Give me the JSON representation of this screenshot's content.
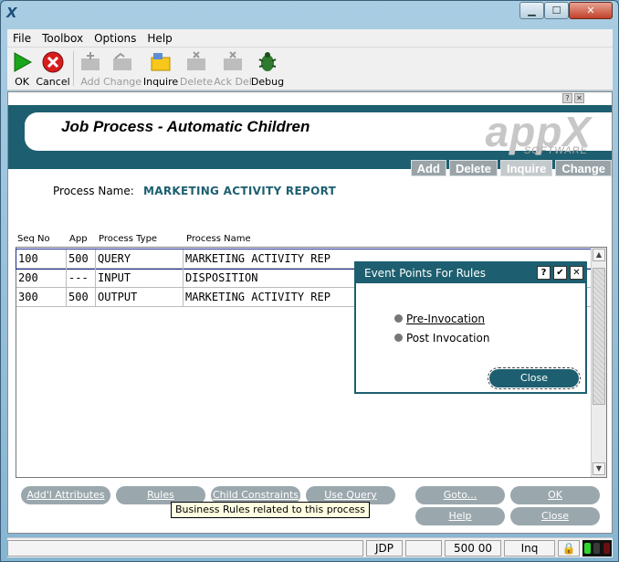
{
  "window": {
    "app_icon": "X"
  },
  "menu": [
    "File",
    "Toolbox",
    "Options",
    "Help"
  ],
  "toolbar": {
    "ok": "OK",
    "cancel": "Cancel",
    "add": "Add",
    "change": "Change",
    "inquire": "Inquire",
    "delete": "Delete",
    "ack_del": "Ack Del",
    "debug": "Debug"
  },
  "header": {
    "title": "Job Process - Automatic Children",
    "logo_text": "appX",
    "logo_sub": "SOFTWARE",
    "mode_tabs": [
      "Add",
      "Delete",
      "Inquire",
      "Change"
    ]
  },
  "process": {
    "label": "Process Name:",
    "value": "MARKETING ACTIVITY REPORT"
  },
  "table": {
    "headers": [
      "Seq No",
      "App",
      "Process Type",
      "Process Name"
    ],
    "rows": [
      {
        "seq": "100",
        "app": "500",
        "type": "QUERY",
        "name": "MARKETING ACTIVITY REP"
      },
      {
        "seq": "200",
        "app": "---",
        "type": "INPUT",
        "name": "DISPOSITION"
      },
      {
        "seq": "300",
        "app": "500",
        "type": "OUTPUT",
        "name": "MARKETING ACTIVITY REP"
      }
    ]
  },
  "popup": {
    "title": "Event Points For Rules",
    "help_btn": "?",
    "ok_btn": "✔",
    "close_btn": "✕",
    "options": [
      "Pre-Invocation",
      "Post Invocation"
    ],
    "close_label": "Close"
  },
  "buttons": {
    "addl_attributes": "Add'l Attributes",
    "rules": "Rules",
    "child_constraints": "Child Constraints",
    "use_query": "Use Query",
    "goto": "Goto...",
    "ok": "OK",
    "help": "Help",
    "close": "Close"
  },
  "tooltip": "Business Rules related to this process",
  "status": {
    "user": "JDP",
    "app_info": "500 00",
    "mode": "Inq"
  }
}
